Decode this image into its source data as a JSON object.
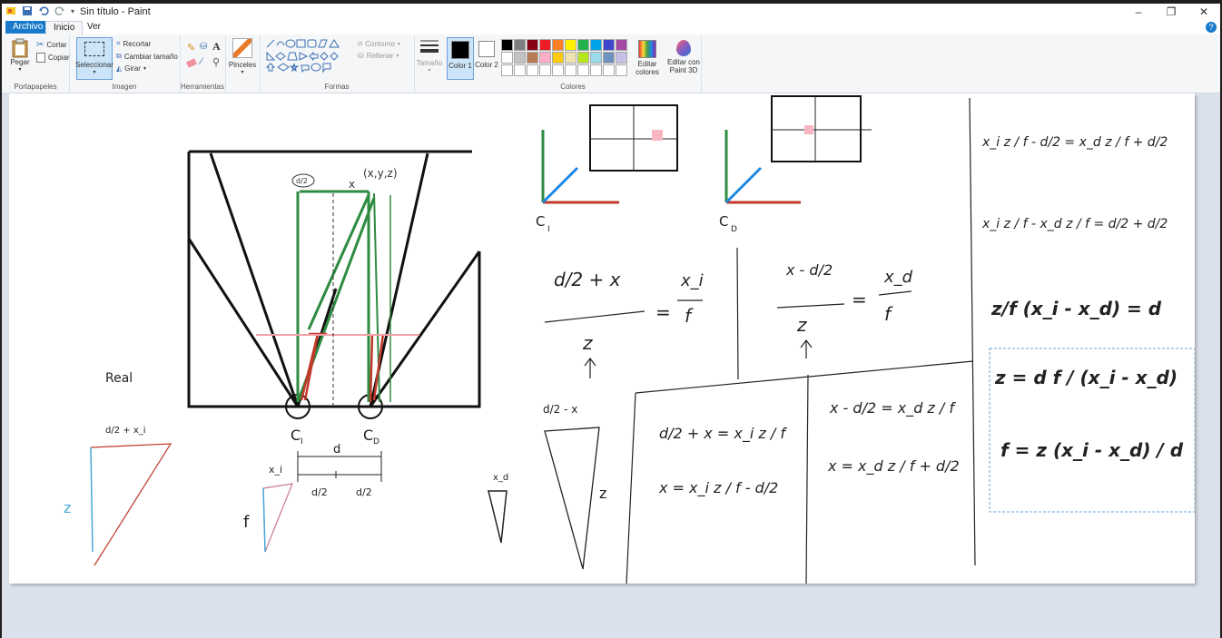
{
  "window": {
    "title": "Sin título - Paint",
    "controls": {
      "minimize": "–",
      "maximize": "❐",
      "close": "✕"
    }
  },
  "tabs": [
    {
      "label": "Archivo"
    },
    {
      "label": "Inicio"
    },
    {
      "label": "Ver"
    }
  ],
  "help": "?",
  "ribbon": {
    "portapapeles": {
      "paste": "Pegar",
      "cut": "Cortar",
      "copy": "Copiar",
      "group": "Portapapeles"
    },
    "imagen": {
      "select": "Seleccionar",
      "crop": "Recortar",
      "resize": "Cambiar tamaño",
      "rotate": "Girar",
      "group": "Imagen"
    },
    "herramientas": {
      "group": "Herramientas"
    },
    "pinceles": {
      "label": "Pinceles"
    },
    "formas": {
      "outline": "Contorno",
      "fill": "Rellenar",
      "group": "Formas"
    },
    "tamano": {
      "label": "Tamaño"
    },
    "colores": {
      "color1": "Color 1",
      "color2": "Color 2",
      "edit": "Editar colores",
      "paint3d": "Editar con Paint 3D",
      "group": "Colores",
      "palette_row1": [
        "#000000",
        "#7f7f7f",
        "#880015",
        "#ed1c24",
        "#ff7f27",
        "#fff200",
        "#22b14c",
        "#00a2e8",
        "#3f48cc",
        "#a349a4"
      ],
      "palette_row2": [
        "#ffffff",
        "#c3c3c3",
        "#b97a57",
        "#ffaec9",
        "#ffc90e",
        "#efe4b0",
        "#b5e61d",
        "#99d9ea",
        "#7092be",
        "#c8bfe7"
      ]
    }
  },
  "canvas_text": {
    "cam_left": "C_I",
    "cam_right": "C_D",
    "cam_left_top": "C_I",
    "cam_right_top": "C_D",
    "real": "Real",
    "d_half_xi": "d/2 + x_i",
    "z_left": "z",
    "f_left": "f",
    "d_label": "d",
    "d2a": "d/2",
    "d2b": "d/2",
    "xi_label": "x_i",
    "xd_label": "x_d",
    "f_mid": "f",
    "z_mid": "z",
    "d2_minus_x": "d/2 - x",
    "eq1_num": "d/2 + x",
    "eq1_rhs_num": "x_i",
    "eq1_den": "z",
    "eq1_rhs_den": "f",
    "eq2_num": "x - d/2",
    "eq2_rhs_num": "x_d",
    "eq2_den": "z",
    "eq2_rhs_den": "f",
    "eq3": "d/2 + x = x_i z / f",
    "eq4": "x = x_i z / f - d/2",
    "eq5": "x - d/2 = x_d z / f",
    "eq6": "x = x_d z / f + d/2",
    "r1": "x_i z / f - d/2 = x_d z / f + d/2",
    "r2": "x_i z / f - x_d z / f = d/2 + d/2",
    "r3": "z/f (x_i - x_d) = d",
    "r4": "z = d f / (x_i - x_d)",
    "r5": "f = z (x_i - x_d) / d",
    "pt_label": "(x,y,z)",
    "x_label": "x"
  }
}
